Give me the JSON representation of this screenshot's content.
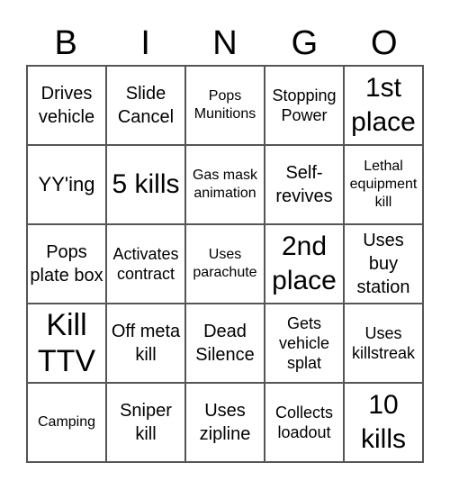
{
  "header": {
    "letters": [
      "B",
      "I",
      "N",
      "G",
      "O"
    ]
  },
  "cells": [
    {
      "text": "Drives vehicle",
      "size": "s3"
    },
    {
      "text": "Slide Cancel",
      "size": "s3"
    },
    {
      "text": "Pops Munitions",
      "size": "s1"
    },
    {
      "text": "Stopping Power",
      "size": "s2"
    },
    {
      "text": "1st place",
      "size": "s5"
    },
    {
      "text": "YY'ing",
      "size": "s4"
    },
    {
      "text": "5 kills",
      "size": "s5"
    },
    {
      "text": "Gas mask animation",
      "size": "s1"
    },
    {
      "text": "Self-revives",
      "size": "s3"
    },
    {
      "text": "Lethal equipment kill",
      "size": "s1"
    },
    {
      "text": "Pops plate box",
      "size": "s3"
    },
    {
      "text": "Activates contract",
      "size": "s2"
    },
    {
      "text": "Uses parachute",
      "size": "s1"
    },
    {
      "text": "2nd place",
      "size": "s5"
    },
    {
      "text": "Uses buy station",
      "size": "s3"
    },
    {
      "text": "Kill TTV",
      "size": "s6"
    },
    {
      "text": "Off meta kill",
      "size": "s3"
    },
    {
      "text": "Dead Silence",
      "size": "s3"
    },
    {
      "text": "Gets vehicle splat",
      "size": "s2"
    },
    {
      "text": "Uses killstreak",
      "size": "s2"
    },
    {
      "text": "Camping",
      "size": "s1"
    },
    {
      "text": "Sniper kill",
      "size": "s3"
    },
    {
      "text": "Uses zipline",
      "size": "s3"
    },
    {
      "text": "Collects loadout",
      "size": "s2"
    },
    {
      "text": "10 kills",
      "size": "s5"
    }
  ]
}
